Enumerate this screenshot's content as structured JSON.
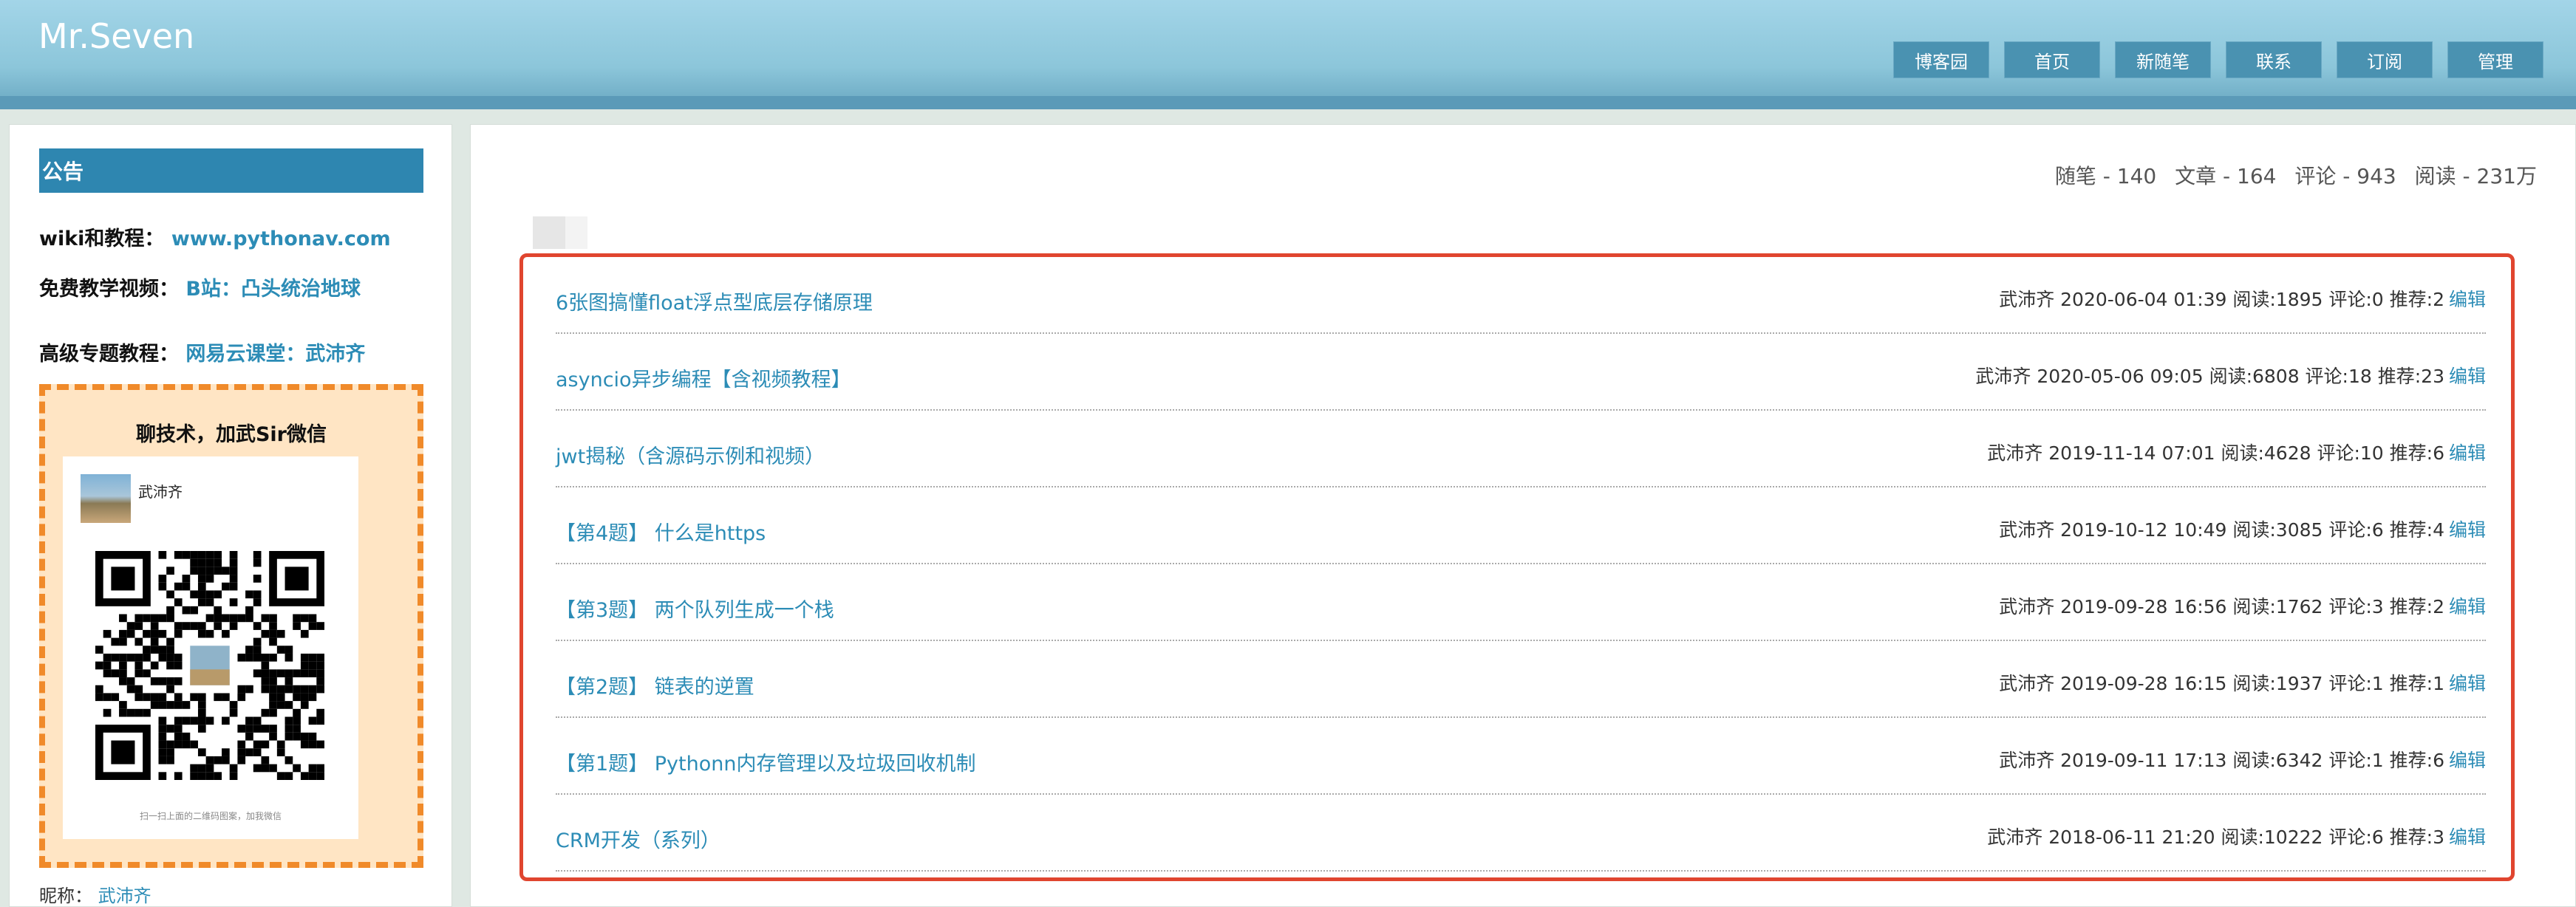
{
  "header": {
    "title": "Mr.Seven",
    "nav": [
      "博客园",
      "首页",
      "新随笔",
      "联系",
      "订阅",
      "管理"
    ]
  },
  "sidebar": {
    "notice_title": "公告",
    "wiki": {
      "label": "wiki和教程：",
      "link": "www.pythonav.com"
    },
    "video": {
      "label": "免费教学视频：",
      "link": "B站：凸头统治地球"
    },
    "course": {
      "label": "高级专题教程：",
      "link": "网易云课堂：武沛齐"
    },
    "qr": {
      "caption": "聊技术，加武Sir微信",
      "name": "武沛齐",
      "hint": "扫一扫上面的二维码图案，加我微信"
    },
    "nickname": {
      "label": "昵称：",
      "value": "武沛齐"
    }
  },
  "stats": [
    "随笔 - 140",
    "文章 - 164",
    "评论 - 943",
    "阅读 - 231万"
  ],
  "posts": [
    {
      "title": "6张图搞懂float浮点型底层存储原理",
      "meta": "武沛齐 2020-06-04 01:39 阅读:1895 评论:0 推荐:2"
    },
    {
      "title": "asyncio异步编程【含视频教程】",
      "meta": "武沛齐 2020-05-06 09:05 阅读:6808 评论:18 推荐:23"
    },
    {
      "title": "jwt揭秘（含源码示例和视频）",
      "meta": "武沛齐 2019-11-14 07:01 阅读:4628 评论:10 推荐:6"
    },
    {
      "title": "【第4题】 什么是https",
      "meta": "武沛齐 2019-10-12 10:49 阅读:3085 评论:6 推荐:4"
    },
    {
      "title": "【第3题】 两个队列生成一个栈",
      "meta": "武沛齐 2019-09-28 16:56 阅读:1762 评论:3 推荐:2"
    },
    {
      "title": "【第2题】 链表的逆置",
      "meta": "武沛齐 2019-09-28 16:15 阅读:1937 评论:1 推荐:1"
    },
    {
      "title": "【第1题】 Pythonn内存管理以及垃圾回收机制",
      "meta": "武沛齐 2019-09-11 17:13 阅读:6342 评论:1 推荐:6"
    },
    {
      "title": "CRM开发（系列）",
      "meta": "武沛齐 2018-06-11 21:20 阅读:10222 评论:6 推荐:3"
    }
  ],
  "edit_label": "编辑",
  "colors": {
    "accent": "#2c8cb6",
    "highlight_border": "#e0452f",
    "qr_border": "#f08a2a"
  }
}
